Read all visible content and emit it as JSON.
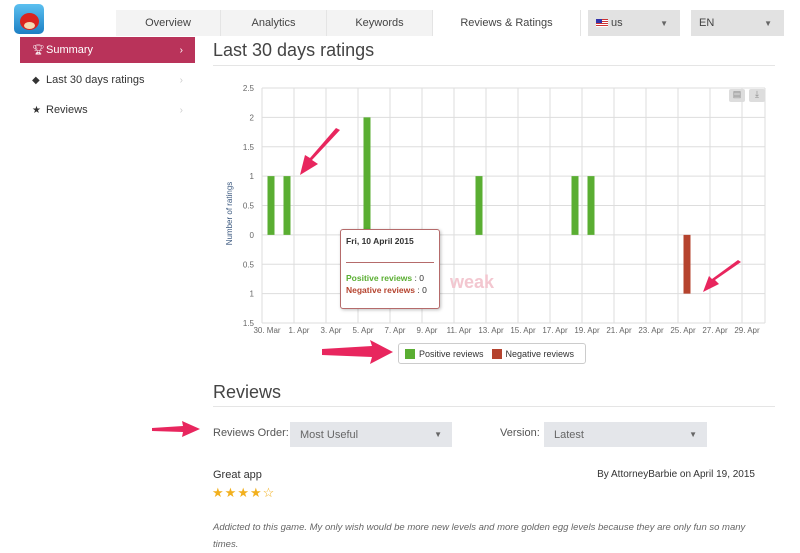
{
  "header": {
    "tabs": [
      {
        "label": "Overview"
      },
      {
        "label": "Analytics"
      },
      {
        "label": "Keywords"
      },
      {
        "label": "Reviews & Ratings",
        "active": true
      }
    ],
    "country": "us",
    "language": "EN"
  },
  "sidebar": {
    "items": [
      {
        "label": "Summary",
        "icon": "trophy-icon",
        "active": true
      },
      {
        "label": "Last 30 days ratings",
        "icon": "tag-icon"
      },
      {
        "label": "Reviews",
        "icon": "star-icon"
      }
    ]
  },
  "ratings_section": {
    "title": "Last 30 days ratings"
  },
  "chart_data": {
    "type": "bar",
    "ylabel": "Number of ratings",
    "ylim": [
      -1.5,
      2.5
    ],
    "yticks": [
      "2.5",
      "2",
      "1.5",
      "1",
      "0.5",
      "0",
      "0.5",
      "1",
      "1.5"
    ],
    "xticks": [
      "30. Mar",
      "1. Apr",
      "3. Apr",
      "5. Apr",
      "7. Apr",
      "9. Apr",
      "11. Apr",
      "13. Apr",
      "15. Apr",
      "17. Apr",
      "19. Apr",
      "21. Apr",
      "23. Apr",
      "25. Apr",
      "27. Apr",
      "29. Apr"
    ],
    "grid": true,
    "legend_position": "bottom",
    "series": [
      {
        "name": "Positive reviews",
        "color": "#5aae32",
        "points": [
          [
            "30. Mar",
            1
          ],
          [
            "31. Mar",
            1
          ],
          [
            "5. Apr",
            2
          ],
          [
            "12. Apr",
            1
          ],
          [
            "18. Apr",
            1
          ],
          [
            "19. Apr",
            1
          ]
        ]
      },
      {
        "name": "Negative reviews",
        "color": "#b5432e",
        "points": [
          [
            "25. Apr",
            -1
          ]
        ]
      }
    ],
    "tooltip": {
      "date": "Fri, 10 April 2015",
      "positive_label": "Positive reviews",
      "positive_value": ": 0",
      "negative_label": "Negative reviews",
      "negative_value": ": 0"
    },
    "watermark": "weak"
  },
  "reviews_section": {
    "title": "Reviews",
    "order_label": "Reviews Order:",
    "order_value": "Most Useful",
    "version_label": "Version:",
    "version_value": "Latest",
    "reviews": [
      {
        "title": "Great app",
        "byline": "By AttorneyBarbie on April 19, 2015",
        "rating": 4,
        "max_rating": 5,
        "text": "Addicted to this game. My only wish would be more new levels and more golden egg levels because they are only fun so many times."
      }
    ]
  }
}
